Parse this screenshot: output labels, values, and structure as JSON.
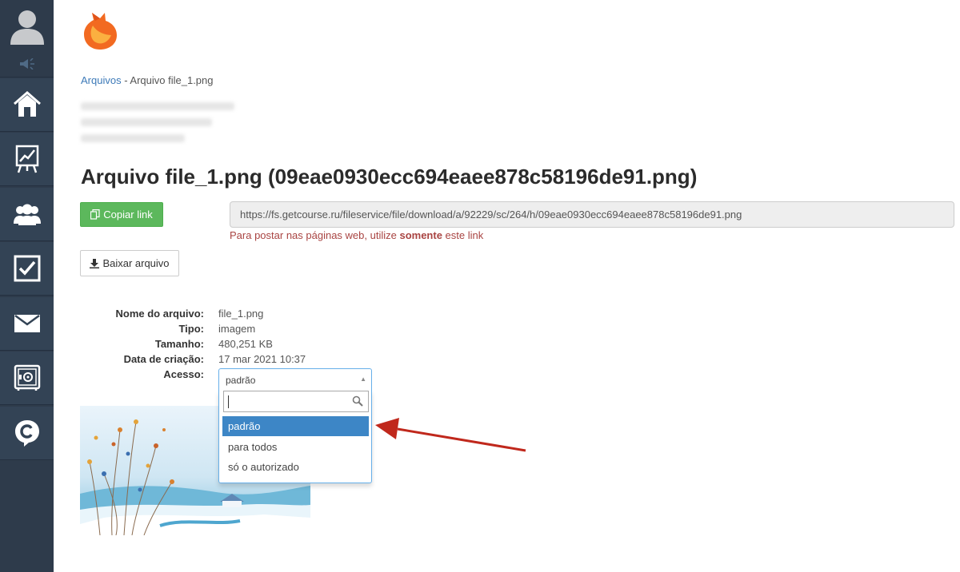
{
  "sidebar": {
    "items": [
      {
        "icon": "home-icon"
      },
      {
        "icon": "chart-board-icon"
      },
      {
        "icon": "users-icon"
      },
      {
        "icon": "checkbox-icon"
      },
      {
        "icon": "mail-icon"
      },
      {
        "icon": "safe-icon"
      },
      {
        "icon": "chat-icon"
      }
    ]
  },
  "breadcrumb": {
    "link": "Arquivos",
    "separator": " - ",
    "current": "Arquivo file_1.png"
  },
  "page": {
    "title": "Arquivo file_1.png (09eae0930ecc694eaee878c58196de91.png)"
  },
  "actions": {
    "copy_label": "Copiar link",
    "download_label": "Baixar arquivo"
  },
  "url": {
    "value": "https://fs.getcourse.ru/fileservice/file/download/a/92229/sc/264/h/09eae0930ecc694eaee878c58196de91.png",
    "note_prefix": "Para postar nas páginas web, utilize ",
    "note_bold": "somente",
    "note_suffix": " este link"
  },
  "properties": [
    {
      "key": "Nome do arquivo:",
      "value": "file_1.png"
    },
    {
      "key": "Tipo:",
      "value": "imagem"
    },
    {
      "key": "Tamanho:",
      "value": "480,251 KB"
    },
    {
      "key": "Data de criação:",
      "value": "17 mar 2021 10:37"
    },
    {
      "key": "Acesso:",
      "value": ""
    }
  ],
  "access_select": {
    "selected": "padrão",
    "search_value": "",
    "options": [
      "padrão",
      "para todos",
      "só o autorizado"
    ],
    "highlighted_index": 0
  },
  "colors": {
    "sidebar": "#2e3b4b",
    "accent_green": "#5cb85c",
    "link_blue": "#3d7ab8",
    "highlight": "#3d86c6",
    "arrow_red": "#c0281c",
    "note_red": "#a94442"
  }
}
